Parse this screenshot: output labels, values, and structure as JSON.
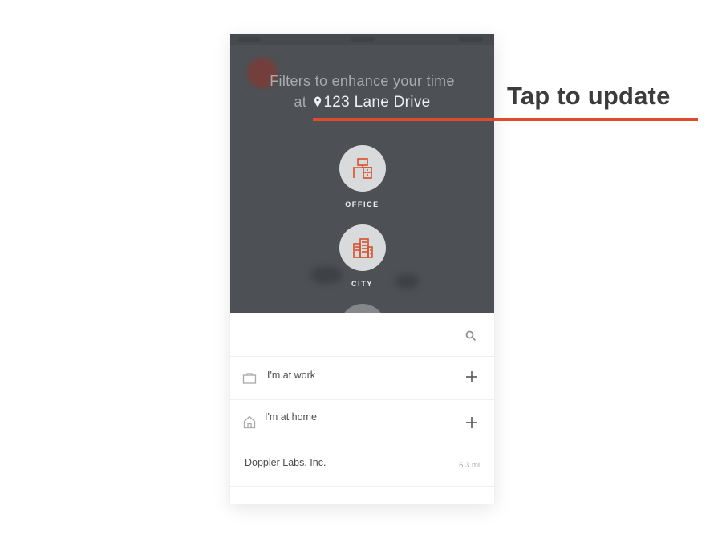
{
  "header": {
    "headline_line1": "Filters to enhance your time",
    "headline_at": "at",
    "address": "123 Lane Drive"
  },
  "filters": [
    {
      "label": "OFFICE",
      "icon": "office-desk-icon"
    },
    {
      "label": "CITY",
      "icon": "city-building-icon"
    }
  ],
  "list": {
    "items": [
      {
        "label": "I'm at work",
        "icon": "briefcase-icon",
        "action": "plus-icon"
      },
      {
        "label": "I'm at home",
        "icon": "home-icon",
        "action": "plus-icon"
      },
      {
        "label": "Doppler Labs, Inc.",
        "distance": "6.3 mi"
      }
    ]
  },
  "annotation": {
    "text": "Tap to update",
    "color": "#e04a2f"
  },
  "colors": {
    "overlay": "#4d5054",
    "accent": "#d2502d",
    "text": "#4a4c4f"
  }
}
